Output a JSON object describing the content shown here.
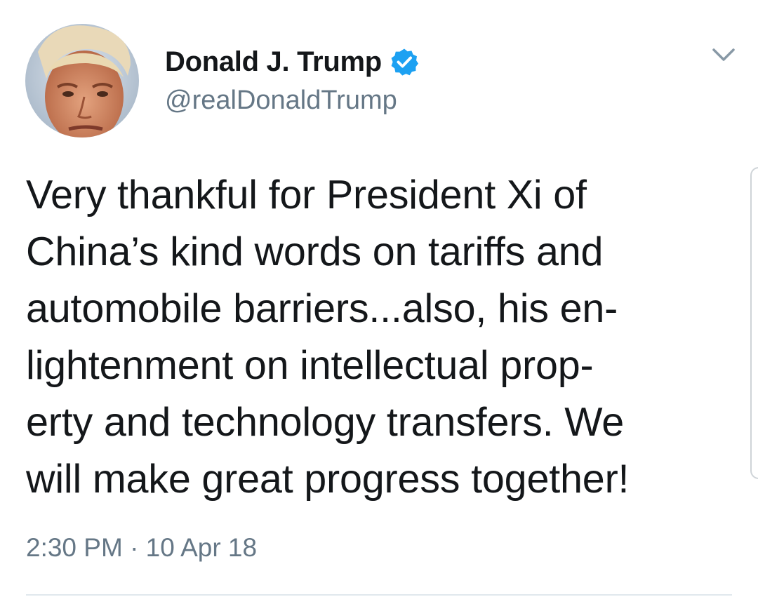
{
  "tweet": {
    "author": {
      "display_name": "Donald J. Trump",
      "handle": "@realDonaldTrump",
      "verified": true,
      "avatar_icon": "profile-photo"
    },
    "text": "Very thankful for President Xi of\nChina’s kind words on tariffs and\nautomobile barriers...also, his en-\nlightenment on intellectual prop-\nerty and technology transfers. We\nwill make great progress together!",
    "timestamp": "2:30 PM · 10 Apr 18",
    "menu_icon": "chevron-down-icon"
  },
  "colors": {
    "text_primary": "#14171a",
    "text_secondary": "#657786",
    "verified_blue": "#1da1f2",
    "divider": "#e1e8ed"
  }
}
